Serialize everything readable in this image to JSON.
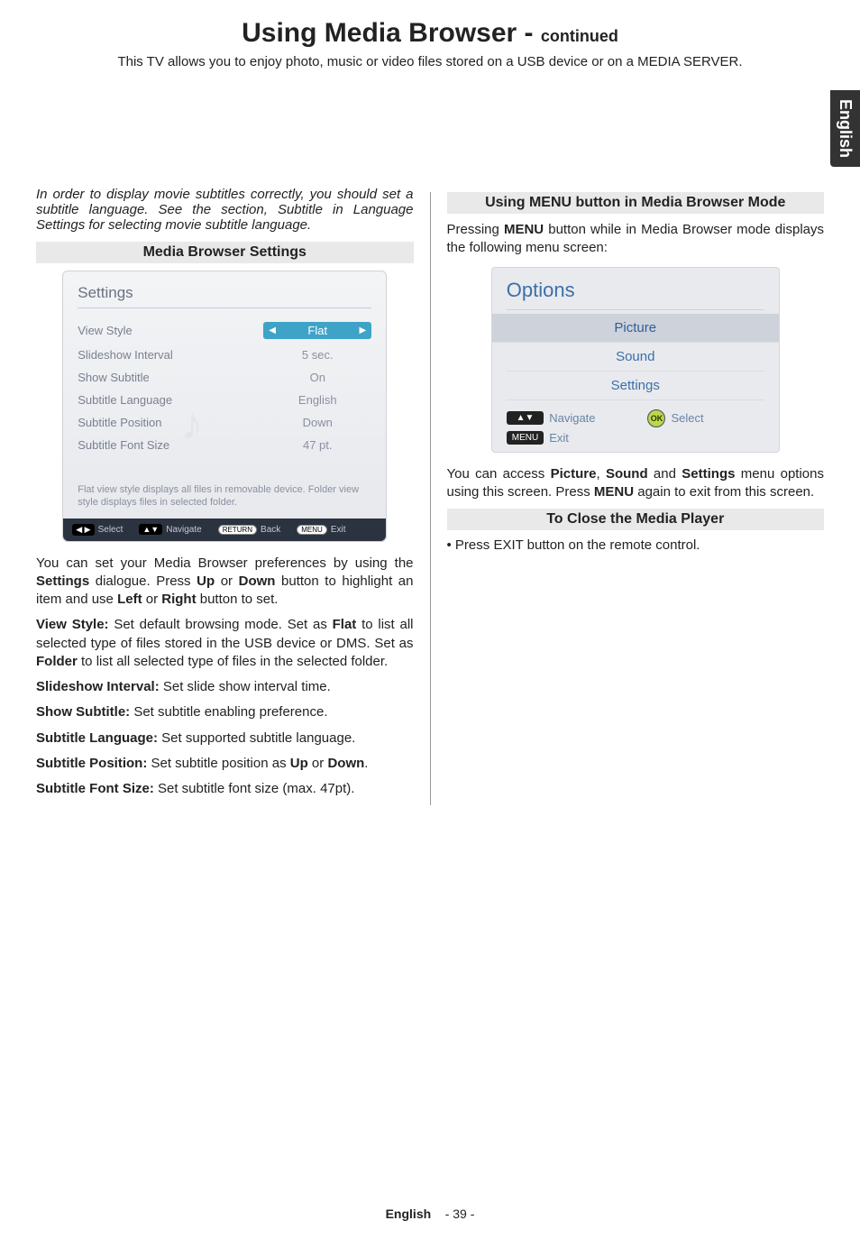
{
  "page": {
    "title_main": "Using Media Browser - ",
    "title_continued": "continued",
    "subtitle": "This TV allows you to enjoy photo, music or video files stored on a USB device or on a MEDIA SERVER.",
    "side_tab": "English",
    "footer_lang": "English",
    "footer_page": "- 39 -"
  },
  "left": {
    "note": "In order to display movie subtitles correctly, you should set a subtitle language. See the section, Subtitle in Language Settings for selecting movie subtitle language.",
    "section_heading": "Media Browser Settings",
    "settings_panel": {
      "title": "Settings",
      "rows": [
        {
          "label": "View Style",
          "value": "Flat",
          "selected": true
        },
        {
          "label": "Slideshow Interval",
          "value": "5 sec."
        },
        {
          "label": "Show Subtitle",
          "value": "On"
        },
        {
          "label": "Subtitle Language",
          "value": "English"
        },
        {
          "label": "Subtitle Position",
          "value": "Down"
        },
        {
          "label": "Subtitle Font Size",
          "value": "47 pt."
        }
      ],
      "description": "Flat view style displays all files in removable device. Folder view style displays files in selected folder.",
      "footer": [
        {
          "key": "◀ ▶",
          "label": "Select"
        },
        {
          "key": "▲▼",
          "label": "Navigate"
        },
        {
          "key": "RETURN",
          "label": "Back"
        },
        {
          "key": "MENU",
          "label": "Exit"
        }
      ]
    },
    "para1_a": "You can set your Media Browser preferences by using the ",
    "para1_b": "Settings",
    "para1_c": " dialogue. Press ",
    "para1_d": "Up",
    "para1_e": " or ",
    "para1_f": "Down",
    "para1_g": " button to highlight an item and use ",
    "para1_h": "Left",
    "para1_i": " or ",
    "para1_j": "Right",
    "para1_k": " button to set.",
    "defs": [
      {
        "term": "View Style:",
        "text": " Set default browsing mode. Set as ",
        "bold2": "Flat",
        "text2": " to list all selected type of files stored in the USB device or DMS. Set as ",
        "bold3": "Folder",
        "text3": " to list all selected type of files in the selected folder."
      },
      {
        "term": "Slideshow Interval:",
        "text": " Set slide show interval time."
      },
      {
        "term": "Show Subtitle:",
        "text": " Set subtitle enabling preference."
      },
      {
        "term": "Subtitle Language:",
        "text": " Set supported subtitle language."
      },
      {
        "term": "Subtitle Position:",
        "text": " Set subtitle position as ",
        "bold2": "Up",
        "text2": " or ",
        "bold3": "Down",
        "text3": "."
      },
      {
        "term": "Subtitle Font Size:",
        "text": " Set subtitle font size (max. 47pt)."
      }
    ]
  },
  "right": {
    "section_heading": "Using MENU button in Media Browser Mode",
    "intro_a": "Pressing ",
    "intro_b": "MENU",
    "intro_c": " button while in Media Browser mode displays the following menu screen:",
    "options_panel": {
      "title": "Options",
      "items": [
        {
          "label": "Picture",
          "highlighted": true
        },
        {
          "label": "Sound"
        },
        {
          "label": "Settings"
        }
      ],
      "footer": {
        "nav_key": "▲▼",
        "nav_label": "Navigate",
        "ok_key": "OK",
        "ok_label": "Select",
        "menu_key": "MENU",
        "menu_label": "Exit"
      }
    },
    "after_a": "You can access ",
    "after_b": "Picture",
    "after_c": ", ",
    "after_d": "Sound",
    "after_e": " and ",
    "after_f": "Settings",
    "after_g": " menu options using this screen. Press ",
    "after_h": "MENU",
    "after_i": " again to exit from this screen.",
    "close_heading": "To Close the Media Player",
    "close_a": "• Press ",
    "close_b": "EXIT",
    "close_c": " button on the remote control."
  }
}
